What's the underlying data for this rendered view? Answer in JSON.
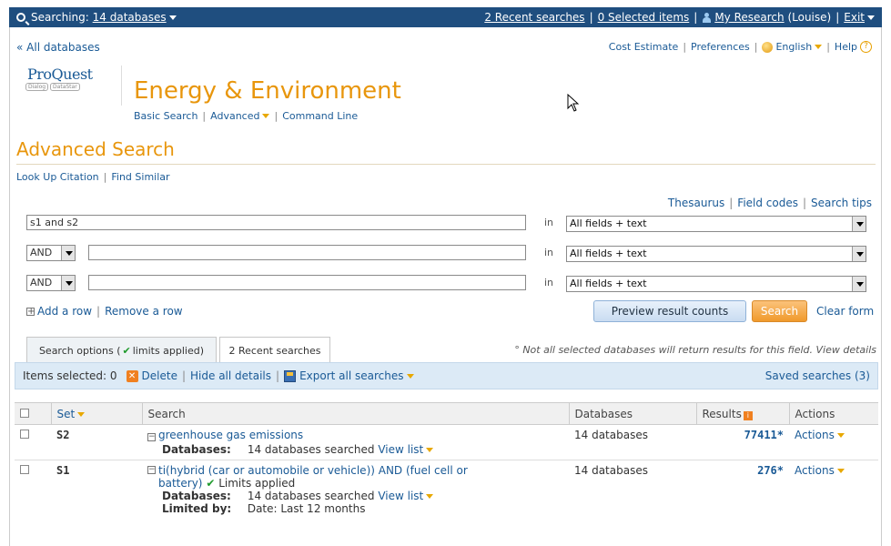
{
  "topbar": {
    "searching_prefix": "Searching:",
    "searching_link": "14 databases",
    "recent_searches": "2 Recent searches",
    "selected_items": "0 Selected items",
    "my_research": "My Research",
    "user": "(Louise)",
    "exit": "Exit"
  },
  "nav": {
    "all_databases": "« All databases",
    "cost_estimate": "Cost Estimate",
    "preferences": "Preferences",
    "language": "English",
    "help": "Help"
  },
  "logo": {
    "name": "ProQuest",
    "dialog": "Dialog",
    "datastar": "DataStar"
  },
  "brand": {
    "title": "Energy & Environment",
    "basic_search": "Basic Search",
    "advanced": "Advanced",
    "command_line": "Command Line"
  },
  "page": {
    "title": "Advanced Search",
    "look_up_citation": "Look Up Citation",
    "find_similar": "Find Similar"
  },
  "tools": {
    "thesaurus": "Thesaurus",
    "field_codes": "Field codes",
    "search_tips": "Search tips"
  },
  "rows": [
    {
      "operator": "",
      "query": "s1 and s2",
      "in_label": "in",
      "field": "All fields + text"
    },
    {
      "operator": "AND",
      "query": "",
      "in_label": "in",
      "field": "All fields + text"
    },
    {
      "operator": "AND",
      "query": "",
      "in_label": "in",
      "field": "All fields + text"
    }
  ],
  "row_actions": {
    "add_row": "Add a row",
    "remove_row": "Remove a row"
  },
  "buttons": {
    "preview": "Preview result counts",
    "search": "Search",
    "clear_form": "Clear form"
  },
  "tabs": {
    "options_prefix": "Search options (",
    "options_limits": "limits applied)",
    "recent": "2 Recent searches"
  },
  "notice": "° Not all selected databases will return results for this field. View details",
  "itembar": {
    "items_selected": "Items selected: 0",
    "delete": "Delete",
    "hide_details": "Hide all details",
    "export": "Export all searches",
    "saved": "Saved searches (3)"
  },
  "table": {
    "headers": [
      "Set",
      "Search",
      "Databases",
      "Results",
      "Actions"
    ],
    "rows": [
      {
        "set": "S2",
        "query": "greenhouse gas emissions",
        "databases_label": "Databases:",
        "databases_detail": "14 databases searched",
        "view_list": "View list",
        "databases": "14 databases",
        "results": "77411*",
        "actions": "Actions"
      },
      {
        "set": "S1",
        "query": "ti(hybrid (car or automobile or vehicle)) AND (fuel cell or battery)",
        "limits": "Limits applied",
        "databases_label": "Databases:",
        "databases_detail": "14 databases searched",
        "view_list": "View list",
        "limited_label": "Limited by:",
        "limited_detail": "Date: Last 12 months",
        "databases": "14 databases",
        "results": "276*",
        "actions": "Actions"
      }
    ]
  },
  "colors": {
    "topbar": "#1f4e7f",
    "accent": "#e8960c",
    "link": "#1a5a96"
  }
}
